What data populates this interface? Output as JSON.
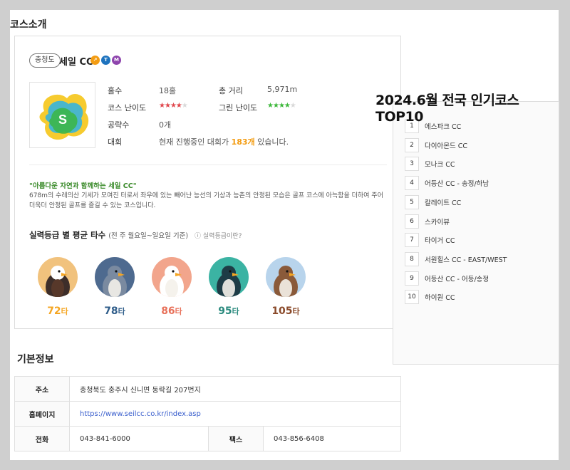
{
  "intro": {
    "title": "코스소개"
  },
  "course": {
    "region": "충청도",
    "name": "세일 CC",
    "tags": [
      {
        "letter": "↗",
        "color": "#f39c12"
      },
      {
        "letter": "T",
        "color": "#1e73be"
      },
      {
        "letter": "M",
        "color": "#8e44ad"
      }
    ],
    "logo_letter": "S",
    "holes_label": "홀수",
    "holes_value": "18홀",
    "distance_label": "총 거리",
    "distance_value": "5,971m",
    "difficulty_label": "코스 난이도",
    "difficulty_rating": 4,
    "difficulty_max": 5,
    "green_label": "그린 난이도",
    "green_rating": 4,
    "green_max": 5,
    "walkthrough_label": "공략수",
    "walkthrough_value": "0개",
    "tournament_label": "대회",
    "tournament_prefix": "현재 진행중인 대회가 ",
    "tournament_count": "183개",
    "tournament_suffix": " 있습니다.",
    "slogan": "\"아름다운 자연과 함께하는 세일 CC\"",
    "description": "678m의 수레의산 기세가 모여진 터로서 좌우에 있는 빼어난 능선의 기상과 능촌의 안정된 모습은 골프 코스에 아늑함을 더하여 주어 더욱더 안정된 골프를 즐길 수 있는 코스입니다.",
    "level_title": "실력등급 별 평균 타수",
    "level_sub": "(전 주 월요일~일요일 기준)",
    "level_help": "실력등급이란?",
    "levels": [
      {
        "score": "72",
        "unit": "타",
        "color": "#f5a623",
        "bg": "#f1c27d",
        "body": "#3d2e2a",
        "bird": "eagle"
      },
      {
        "score": "78",
        "unit": "타",
        "color": "#2f5d8a",
        "bg": "#4e6a8f",
        "body": "#7a8aa0",
        "bird": "hawk"
      },
      {
        "score": "86",
        "unit": "타",
        "color": "#e8715a",
        "bg": "#f2a58c",
        "body": "#ffffff",
        "bird": "swan"
      },
      {
        "score": "95",
        "unit": "타",
        "color": "#2a8a7e",
        "bg": "#3bb3a3",
        "body": "#1e3c46",
        "bird": "penguin"
      },
      {
        "score": "105",
        "unit": "타",
        "color": "#8a4a2a",
        "bg": "#b8d4ec",
        "body": "#8a5a3a",
        "bird": "sparrow"
      }
    ]
  },
  "top10": {
    "title": "2024.6월 전국 인기코스 TOP10",
    "items": [
      {
        "rank": "1",
        "name": "에스파크 CC"
      },
      {
        "rank": "2",
        "name": "다이아몬드 CC"
      },
      {
        "rank": "3",
        "name": "모나크 CC"
      },
      {
        "rank": "4",
        "name": "어등산 CC - 송정/하남"
      },
      {
        "rank": "5",
        "name": "칼레이트 CC"
      },
      {
        "rank": "6",
        "name": "스카이뷰"
      },
      {
        "rank": "7",
        "name": "타이거 CC"
      },
      {
        "rank": "8",
        "name": "서원힐스 CC - EAST/WEST"
      },
      {
        "rank": "9",
        "name": "어등산 CC - 어등/송정"
      },
      {
        "rank": "10",
        "name": "하이원 CC"
      }
    ]
  },
  "info": {
    "title": "기본정보",
    "address_label": "주소",
    "address_value": "충청북도 충주시 신니면 동락길 207번지",
    "homepage_label": "홈페이지",
    "homepage_value": "https://www.seilcc.co.kr/index.asp",
    "phone_label": "전화",
    "phone_value": "043-841-6000",
    "fax_label": "팩스",
    "fax_value": "043-856-6408"
  }
}
